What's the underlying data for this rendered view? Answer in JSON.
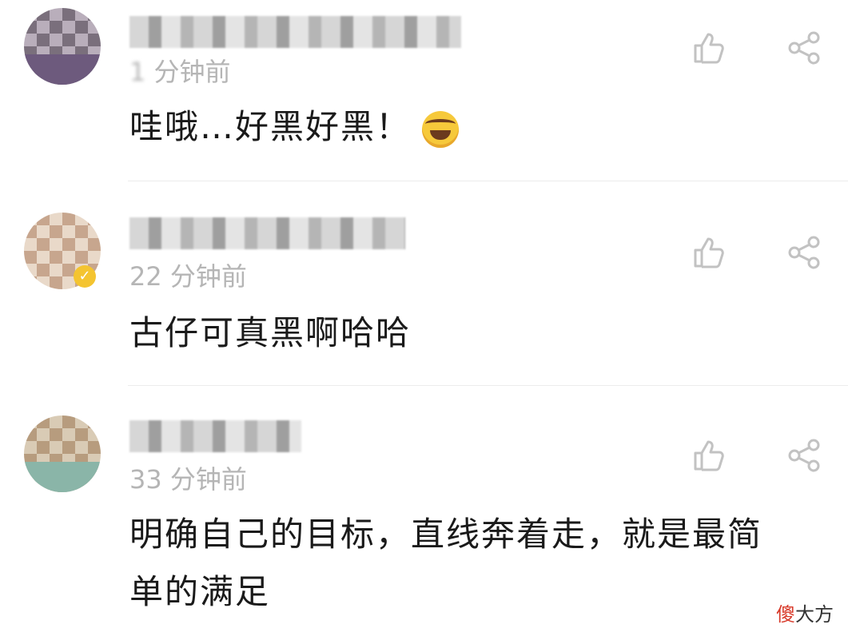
{
  "comments": [
    {
      "time": "分钟前",
      "text": "哇哦…好黑好黑！",
      "emoji": "laughing-crying-emoji"
    },
    {
      "time": "22 分钟前",
      "text": "古仔可真黑啊哈哈"
    },
    {
      "time": "33 分钟前",
      "text_line1": "明确自己的目标，直线奔着走，就是最简",
      "text_line2": "单的满足"
    }
  ],
  "icons": {
    "like": "thumbs-up-icon",
    "share": "share-icon"
  },
  "watermark": {
    "accent": "傻",
    "rest": "大方"
  },
  "colors": {
    "time_text": "#b5b5b5",
    "action_icon": "#c2c2c2",
    "verified_badge": "#f4c430",
    "watermark_accent": "#d83a2a"
  }
}
